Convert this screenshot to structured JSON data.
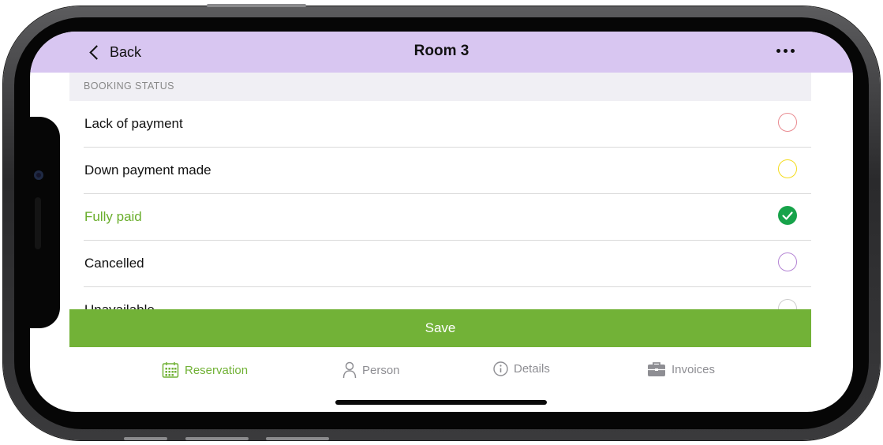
{
  "nav": {
    "back_label": "Back",
    "title": "Room 3"
  },
  "section": {
    "header": "BOOKING STATUS"
  },
  "statuses": [
    {
      "label": "Lack of payment",
      "color": "#e98a90",
      "selected": false
    },
    {
      "label": "Down payment made",
      "color": "#f4dc1e",
      "selected": false
    },
    {
      "label": "Fully paid",
      "color": "#17a34a",
      "selected": true
    },
    {
      "label": "Cancelled",
      "color": "#b484d4",
      "selected": false
    },
    {
      "label": "Unavailable",
      "color": "#cccccc",
      "selected": false
    }
  ],
  "actions": {
    "save_label": "Save"
  },
  "tabs": [
    {
      "label": "Reservation",
      "icon": "calendar-icon",
      "active": true
    },
    {
      "label": "Person",
      "icon": "person-icon",
      "active": false
    },
    {
      "label": "Details",
      "icon": "info-icon",
      "active": false
    },
    {
      "label": "Invoices",
      "icon": "briefcase-icon",
      "active": false
    }
  ],
  "colors": {
    "nav_bg": "#d8c6f1",
    "accent": "#72b237",
    "selected_text": "#6aae2c",
    "check": "#17a34a"
  }
}
